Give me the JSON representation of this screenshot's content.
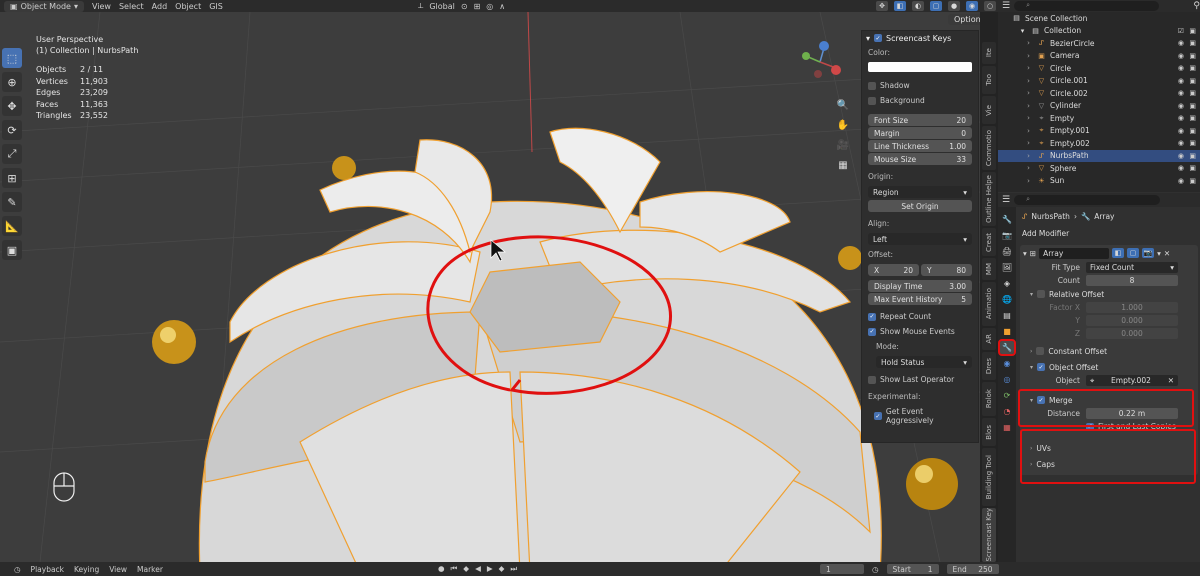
{
  "header": {
    "mode": "Object Mode",
    "menus": [
      "View",
      "Select",
      "Add",
      "Object",
      "GIS"
    ],
    "orientation": "Global",
    "options_label": "Options"
  },
  "viewport": {
    "perspective": "User Perspective",
    "collection": "(1) Collection | NurbsPath",
    "stats": [
      {
        "label": "Objects",
        "value": "2 / 11"
      },
      {
        "label": "Vertices",
        "value": "11,903"
      },
      {
        "label": "Edges",
        "value": "23,209"
      },
      {
        "label": "Faces",
        "value": "11,363"
      },
      {
        "label": "Triangles",
        "value": "23,552"
      }
    ]
  },
  "screencast": {
    "title": "Screencast Keys",
    "color_label": "Color:",
    "shadow": "Shadow",
    "background": "Background",
    "font_size": {
      "label": "Font Size",
      "value": "20"
    },
    "margin": {
      "label": "Margin",
      "value": "0"
    },
    "line_thickness": {
      "label": "Line Thickness",
      "value": "1.00"
    },
    "mouse_size": {
      "label": "Mouse Size",
      "value": "33"
    },
    "origin_label": "Origin:",
    "origin_value": "Region",
    "set_origin": "Set Origin",
    "align_label": "Align:",
    "align_value": "Left",
    "offset_label": "Offset:",
    "offset_x_label": "X",
    "offset_x": "20",
    "offset_y_label": "Y",
    "offset_y": "80",
    "display_time": {
      "label": "Display Time",
      "value": "3.00"
    },
    "max_history": {
      "label": "Max Event History",
      "value": "5"
    },
    "repeat_count": "Repeat Count",
    "show_mouse": "Show Mouse Events",
    "mode_label": "Mode:",
    "mode_value": "Hold Status",
    "show_last_op": "Show Last Operator",
    "experimental_label": "Experimental:",
    "get_event": "Get Event Aggressively"
  },
  "vtabs": [
    "Ite",
    "Too",
    "Vie",
    "Commotio",
    "Outline Helpe",
    "Creat",
    "MM",
    "Animatio",
    "AR",
    "Dres",
    "Rolok",
    "Blos",
    "Building Tool",
    "Screencast Key"
  ],
  "outliner": {
    "root": "Scene Collection",
    "collection": "Collection",
    "items": [
      {
        "name": "BezierCircle",
        "icon": "curve-icon",
        "color": "#e0a050"
      },
      {
        "name": "Camera",
        "icon": "camera-icon",
        "color": "#e0a050"
      },
      {
        "name": "Circle",
        "icon": "mesh-icon",
        "color": "#e0a050"
      },
      {
        "name": "Circle.001",
        "icon": "mesh-icon",
        "color": "#e0a050"
      },
      {
        "name": "Circle.002",
        "icon": "mesh-icon",
        "color": "#e0a050"
      },
      {
        "name": "Cylinder",
        "icon": "mesh-icon",
        "color": "#999999"
      },
      {
        "name": "Empty",
        "icon": "empty-icon",
        "color": "#999999"
      },
      {
        "name": "Empty.001",
        "icon": "empty-icon",
        "color": "#e0a050"
      },
      {
        "name": "Empty.002",
        "icon": "empty-icon",
        "color": "#e0a050"
      },
      {
        "name": "NurbsPath",
        "icon": "curve-icon",
        "color": "#e0a050"
      },
      {
        "name": "Sphere",
        "icon": "mesh-icon",
        "color": "#e0a050"
      },
      {
        "name": "Sun",
        "icon": "light-icon",
        "color": "#e0a050"
      }
    ]
  },
  "properties": {
    "object": "NurbsPath",
    "modifier_crumb": "Array",
    "add_modifier": "Add Modifier",
    "modifier_name": "Array",
    "fit_type_label": "Fit Type",
    "fit_type": "Fixed Count",
    "count_label": "Count",
    "count": "8",
    "relative_offset": "Relative Offset",
    "factor_x_label": "Factor X",
    "factor_x": "1.000",
    "factor_y_label": "Y",
    "factor_y": "0.000",
    "factor_z_label": "Z",
    "factor_z": "0.000",
    "constant_offset": "Constant Offset",
    "object_offset": "Object Offset",
    "object_label": "Object",
    "object_value": "Empty.002",
    "merge": "Merge",
    "distance_label": "Distance",
    "distance": "0.22 m",
    "first_last": "First and Last Copies",
    "uvs": "UVs",
    "caps": "Caps"
  },
  "timeline": {
    "menus": [
      "Playback",
      "Keying",
      "View",
      "Marker"
    ],
    "current_frame": "1",
    "start_label": "Start",
    "start": "1",
    "end_label": "End",
    "end": "250"
  },
  "colors": {
    "accent": "#4772b3",
    "annotation_red": "#e01010",
    "selection_orange": "#f0a030"
  }
}
